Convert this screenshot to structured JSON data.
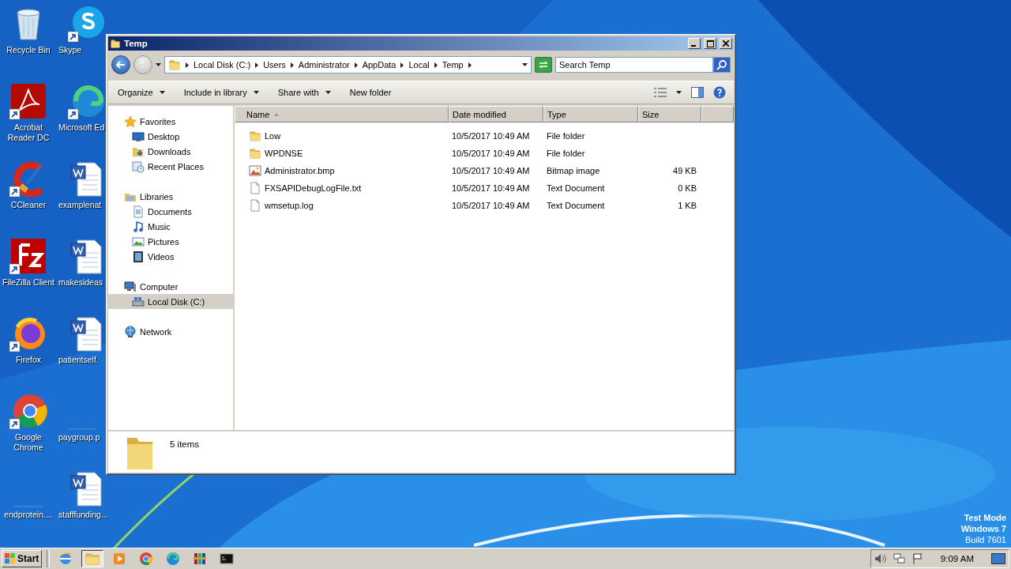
{
  "desktop_icons": [
    {
      "label": "Recycle Bin",
      "kind": "recycle"
    },
    {
      "label": "Skype",
      "kind": "skype"
    },
    {
      "label": "Acrobat Reader DC",
      "kind": "acrobat"
    },
    {
      "label": "Microsoft Ed",
      "kind": "edge"
    },
    {
      "label": "CCleaner",
      "kind": "ccleaner"
    },
    {
      "label": "examplenat",
      "kind": "word"
    },
    {
      "label": "FileZilla Client",
      "kind": "filezilla"
    },
    {
      "label": "makesideas",
      "kind": "word"
    },
    {
      "label": "Firefox",
      "kind": "firefox"
    },
    {
      "label": "patientself.",
      "kind": "word"
    },
    {
      "label": "Google Chrome",
      "kind": "chrome"
    },
    {
      "label": "paygroup.p",
      "kind": "blank"
    },
    {
      "label": "endprotein....",
      "kind": "blank"
    },
    {
      "label": "stafffunding...",
      "kind": "word"
    }
  ],
  "window": {
    "title": "Temp",
    "address": {
      "crumbs": [
        "Local Disk (C:)",
        "Users",
        "Administrator",
        "AppData",
        "Local",
        "Temp"
      ]
    },
    "search": {
      "placeholder": "Search Temp"
    },
    "toolbar": [
      {
        "label": "Organize",
        "dropdown": true
      },
      {
        "label": "Include in library",
        "dropdown": true
      },
      {
        "label": "Share with",
        "dropdown": true
      },
      {
        "label": "New folder",
        "dropdown": false
      }
    ],
    "navigation": [
      {
        "label": "Favorites",
        "kind": "star",
        "selected": false,
        "children": [
          {
            "label": "Desktop",
            "kind": "desktop",
            "selected": false
          },
          {
            "label": "Downloads",
            "kind": "downloads",
            "selected": false
          },
          {
            "label": "Recent Places",
            "kind": "recent",
            "selected": false
          }
        ]
      },
      {
        "label": "Libraries",
        "kind": "libraries",
        "selected": false,
        "children": [
          {
            "label": "Documents",
            "kind": "documents",
            "selected": false
          },
          {
            "label": "Music",
            "kind": "music",
            "selected": false
          },
          {
            "label": "Pictures",
            "kind": "pictures",
            "selected": false
          },
          {
            "label": "Videos",
            "kind": "videos",
            "selected": false
          }
        ]
      },
      {
        "label": "Computer",
        "kind": "computer",
        "selected": false,
        "children": [
          {
            "label": "Local Disk (C:)",
            "kind": "disk",
            "selected": true
          }
        ]
      },
      {
        "label": "Network",
        "kind": "network",
        "selected": false
      }
    ],
    "table": {
      "columns": [
        "Name",
        "Date modified",
        "Type",
        "Size"
      ],
      "rows": [
        {
          "kind": "folder",
          "name": "Low",
          "date": "10/5/2017 10:49 AM",
          "type": "File folder"
        },
        {
          "kind": "folder",
          "name": "WPDNSE",
          "date": "10/5/2017 10:49 AM",
          "type": "File folder"
        },
        {
          "kind": "bitmap",
          "name": "Administrator.bmp",
          "date": "10/5/2017 10:49 AM",
          "type": "Bitmap image",
          "size": "49 KB"
        },
        {
          "kind": "text",
          "name": "FXSAPIDebugLogFile.txt",
          "date": "10/5/2017 10:49 AM",
          "type": "Text Document",
          "size": "0 KB"
        },
        {
          "kind": "text",
          "name": "wmsetup.log",
          "date": "10/5/2017 10:49 AM",
          "type": "Text Document",
          "size": "1 KB"
        }
      ]
    },
    "details": {
      "count": "5 items"
    }
  },
  "watermark_lines": [
    "Test Mode",
    "Windows 7",
    "Build 7601"
  ],
  "taskbar": {
    "start": "Start",
    "apps": [
      {
        "kind": "ie",
        "selected": false
      },
      {
        "kind": "explorer",
        "selected": true
      },
      {
        "kind": "media",
        "selected": false
      },
      {
        "kind": "chrome",
        "selected": false
      },
      {
        "kind": "edge",
        "selected": false
      },
      {
        "kind": "winrar",
        "selected": false
      },
      {
        "kind": "cmd",
        "selected": false
      }
    ],
    "clock": "9:09 AM"
  }
}
